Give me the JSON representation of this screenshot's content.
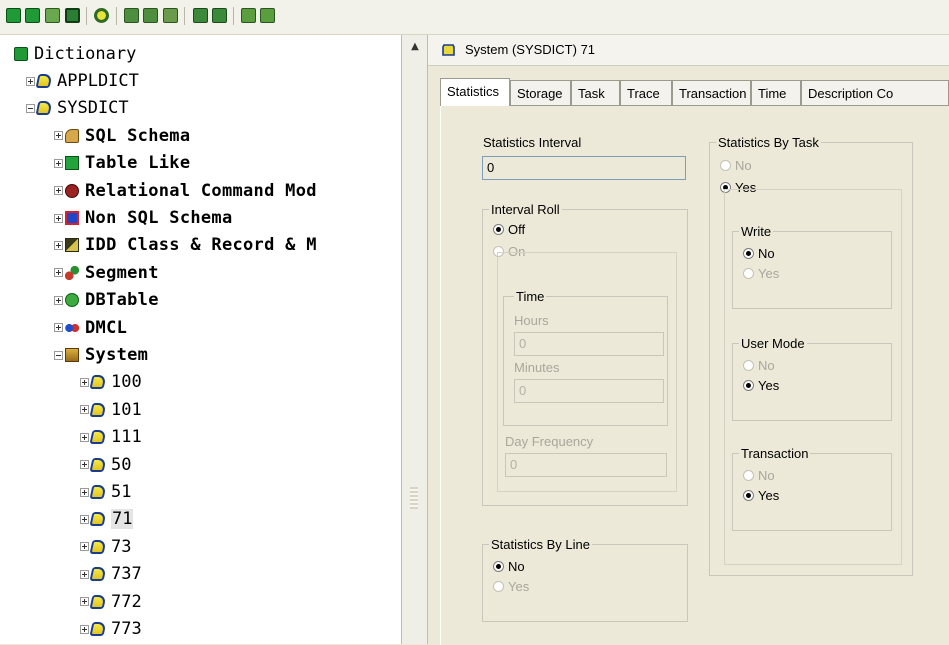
{
  "toolbar": {
    "buttons": [
      "green-db-icon",
      "green-db-icon",
      "db-grid-icon",
      "stop-icon",
      "refresh-icon",
      "table-icon",
      "table-icon",
      "table-icon",
      "schema-icon",
      "schema-icon",
      "node-icon",
      "node-icon"
    ]
  },
  "tree": {
    "root": "Dictionary",
    "items": [
      {
        "label": "APPLDICT",
        "expander": "plus",
        "icon": "yellow-db"
      },
      {
        "label": "SYSDICT",
        "expander": "minus",
        "icon": "yellow-db"
      },
      {
        "label": "SQL Schema",
        "expander": "plus",
        "icon": "sql"
      },
      {
        "label": "Table Like",
        "expander": "plus",
        "icon": "table"
      },
      {
        "label": "Relational Command Mod",
        "expander": "plus",
        "icon": "rel"
      },
      {
        "label": "Non SQL Schema",
        "expander": "plus",
        "icon": "nonsql"
      },
      {
        "label": "IDD Class & Record & M",
        "expander": "plus",
        "icon": "idd"
      },
      {
        "label": "Segment",
        "expander": "plus",
        "icon": "seg"
      },
      {
        "label": "DBTable",
        "expander": "plus",
        "icon": "dbtable"
      },
      {
        "label": "DMCL",
        "expander": "plus",
        "icon": "dmcl"
      },
      {
        "label": "System",
        "expander": "minus",
        "icon": "system"
      },
      {
        "label": "100",
        "expander": "plus",
        "icon": "yellow-db"
      },
      {
        "label": "101",
        "expander": "plus",
        "icon": "yellow-db"
      },
      {
        "label": "111",
        "expander": "plus",
        "icon": "yellow-db"
      },
      {
        "label": "50",
        "expander": "plus",
        "icon": "yellow-db"
      },
      {
        "label": "51",
        "expander": "plus",
        "icon": "yellow-db"
      },
      {
        "label": "71",
        "expander": "plus",
        "icon": "yellow-db",
        "selected": true
      },
      {
        "label": "73",
        "expander": "plus",
        "icon": "yellow-db"
      },
      {
        "label": "737",
        "expander": "plus",
        "icon": "yellow-db"
      },
      {
        "label": "772",
        "expander": "plus",
        "icon": "yellow-db"
      },
      {
        "label": "773",
        "expander": "plus",
        "icon": "yellow-db"
      }
    ]
  },
  "detail": {
    "title": "System (SYSDICT) 71",
    "tabs": [
      "Statistics",
      "Storage",
      "Task",
      "Trace",
      "Transaction",
      "Time",
      "Description Co"
    ],
    "statistics_interval": {
      "label": "Statistics Interval",
      "value": "0"
    },
    "interval_roll": {
      "title": "Interval Roll",
      "off": "Off",
      "on": "On",
      "time": {
        "title": "Time",
        "hours_label": "Hours",
        "hours_value": "0",
        "minutes_label": "Minutes",
        "minutes_value": "0"
      },
      "day_frequency": {
        "label": "Day Frequency",
        "value": "0"
      }
    },
    "statistics_by_line": {
      "title": "Statistics By Line",
      "no": "No",
      "yes": "Yes"
    },
    "statistics_by_task": {
      "title": "Statistics By Task",
      "no": "No",
      "yes": "Yes",
      "write": {
        "title": "Write",
        "no": "No",
        "yes": "Yes"
      },
      "user_mode": {
        "title": "User Mode",
        "no": "No",
        "yes": "Yes"
      },
      "transaction": {
        "title": "Transaction",
        "no": "No",
        "yes": "Yes"
      }
    }
  }
}
